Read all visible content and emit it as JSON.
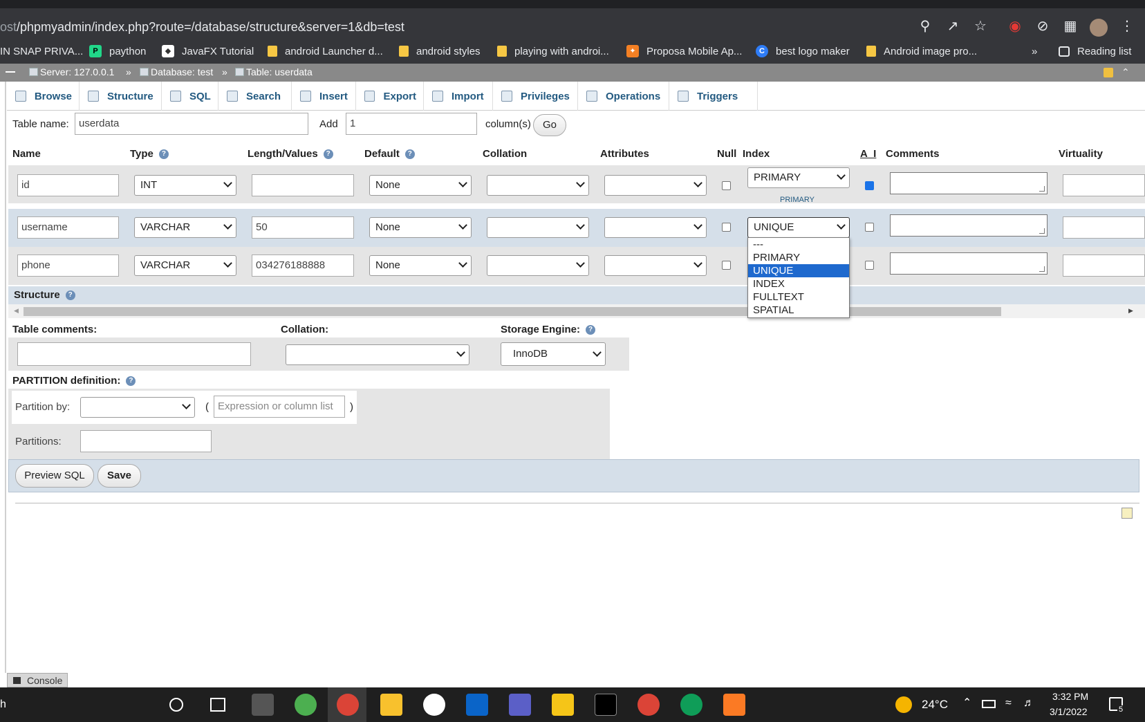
{
  "browser": {
    "url_dim": "ost",
    "url_main": "/phpmyadmin/index.php?route=/database/structure&server=1&db=test",
    "icons": [
      "zoom-icon",
      "share-icon",
      "star-icon",
      "extension-red-icon",
      "block-icon",
      "puzzle-icon",
      "avatar",
      "menu-dots-icon"
    ]
  },
  "bookmarks": [
    {
      "label": "IN SNAP PRIVA...",
      "icon": "none"
    },
    {
      "label": "paython",
      "icon": "pycharm-icon",
      "color": "#21d789"
    },
    {
      "label": "JavaFX Tutorial",
      "icon": "javafx-icon",
      "color": "#ffffff"
    },
    {
      "label": "android Launcher d...",
      "icon": "folder-icon"
    },
    {
      "label": "android styles",
      "icon": "folder-icon"
    },
    {
      "label": "playing with androi...",
      "icon": "folder-icon"
    },
    {
      "label": "Proposa Mobile Ap...",
      "icon": "proposa-icon",
      "color": "#f48024"
    },
    {
      "label": "best logo maker",
      "icon": "canva-icon",
      "color": "#2e7cf6"
    },
    {
      "label": "Android image pro...",
      "icon": "folder-icon"
    }
  ],
  "bookmarks_more": "»",
  "reading_list": "Reading list",
  "breadcrumb": {
    "server": "Server: 127.0.0.1",
    "sep": "»",
    "database": "Database: test",
    "table": "Table: userdata"
  },
  "tabs": [
    "Browse",
    "Structure",
    "SQL",
    "Search",
    "Insert",
    "Export",
    "Import",
    "Privileges",
    "Operations",
    "Triggers"
  ],
  "form": {
    "table_name_label": "Table name:",
    "table_name": "userdata",
    "add_label": "Add",
    "add_count": "1",
    "columns_label": "column(s)",
    "go": "Go"
  },
  "headers": {
    "name": "Name",
    "type": "Type",
    "length": "Length/Values",
    "default": "Default",
    "collation": "Collation",
    "attributes": "Attributes",
    "null": "Null",
    "index": "Index",
    "ai": "A_I",
    "comments": "Comments",
    "virtuality": "Virtuality"
  },
  "rows": [
    {
      "name": "id",
      "type": "INT",
      "length": "",
      "default": "None",
      "index": "PRIMARY",
      "index_note": "PRIMARY",
      "ai": true
    },
    {
      "name": "username",
      "type": "VARCHAR",
      "length": "50",
      "default": "None",
      "index": "UNIQUE",
      "index_note": "",
      "ai": false
    },
    {
      "name": "phone",
      "type": "VARCHAR",
      "length": "034276188888",
      "default": "None",
      "index": "",
      "index_note": "",
      "ai": false
    }
  ],
  "index_options": [
    "---",
    "PRIMARY",
    "UNIQUE",
    "INDEX",
    "FULLTEXT",
    "SPATIAL"
  ],
  "index_selected": "UNIQUE",
  "structure_label": "Structure",
  "table_comments_label": "Table comments:",
  "collation_label": "Collation:",
  "storage_label": "Storage Engine:",
  "storage_value": "InnoDB",
  "partition": {
    "label": "PARTITION definition:",
    "by_label": "Partition by:",
    "paren_open": "(",
    "expr_placeholder": "Expression or column list",
    "paren_close": ")",
    "partitions_label": "Partitions:"
  },
  "buttons": {
    "preview": "Preview SQL",
    "save": "Save"
  },
  "console": "Console",
  "taskbar": {
    "search_partial": "h",
    "weather": "24°C",
    "time": "3:32 PM",
    "date": "3/1/2022",
    "notif_count": "5"
  }
}
